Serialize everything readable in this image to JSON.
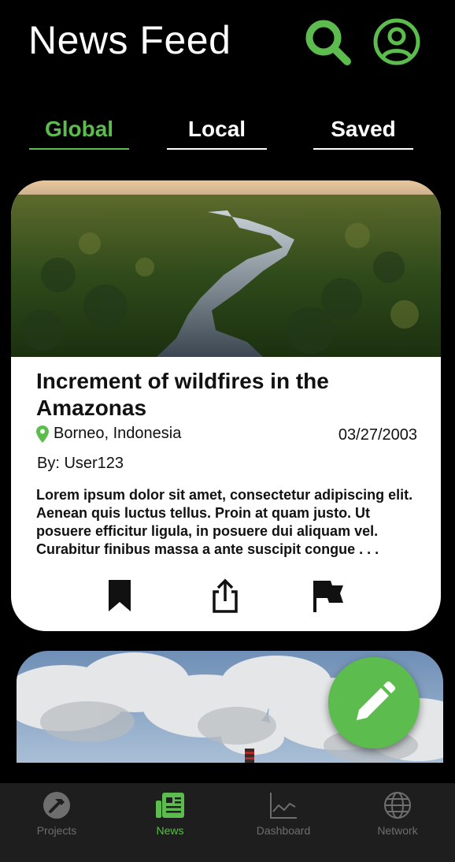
{
  "header": {
    "title": "News Feed"
  },
  "icons": {
    "search": "search-icon",
    "profile": "user-circle-icon"
  },
  "tabs": [
    {
      "label": "Global",
      "active": true
    },
    {
      "label": "Local",
      "active": false
    },
    {
      "label": "Saved",
      "active": false
    }
  ],
  "article": {
    "title": "Increment of wildfires in the Amazonas",
    "location": "Borneo, Indonesia",
    "date": "03/27/2003",
    "author": "By: User123",
    "body": "Lorem ipsum dolor sit amet, consectetur adipiscing elit. Aenean quis luctus tellus. Proin at quam justo. Ut posuere efficitur ligula, in posuere dui aliquam vel. Curabitur finibus massa a ante suscipit congue . . ."
  },
  "nav": [
    {
      "label": "Projects",
      "icon": "hammer-icon",
      "active": false
    },
    {
      "label": "News",
      "icon": "newspaper-icon",
      "active": true
    },
    {
      "label": "Dashboard",
      "icon": "chart-icon",
      "active": false
    },
    {
      "label": "Network",
      "icon": "globe-icon",
      "active": false
    }
  ],
  "colors": {
    "accent": "#5cbc4d",
    "background": "#000000",
    "navbar": "#1e1e1e",
    "card": "#ffffff",
    "inactive": "#6e6e6e"
  }
}
